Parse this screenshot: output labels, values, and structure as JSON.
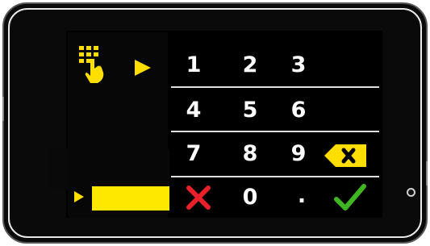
{
  "keypad": {
    "rows": [
      [
        "1",
        "2",
        "3"
      ],
      [
        "4",
        "5",
        "6"
      ],
      [
        "7",
        "8",
        "9"
      ]
    ],
    "bottom": {
      "zero": "0",
      "dot": "."
    }
  },
  "icons": {
    "keypad": "keypad-touch-icon",
    "cancel": "cancel-x-icon",
    "confirm": "confirm-check-icon",
    "backspace": "backspace-icon",
    "pointer": "play-arrow-icon"
  },
  "colors": {
    "accent": "#ffde00",
    "cancel": "#e8202a",
    "confirm": "#3fb521",
    "background": "#000000"
  }
}
